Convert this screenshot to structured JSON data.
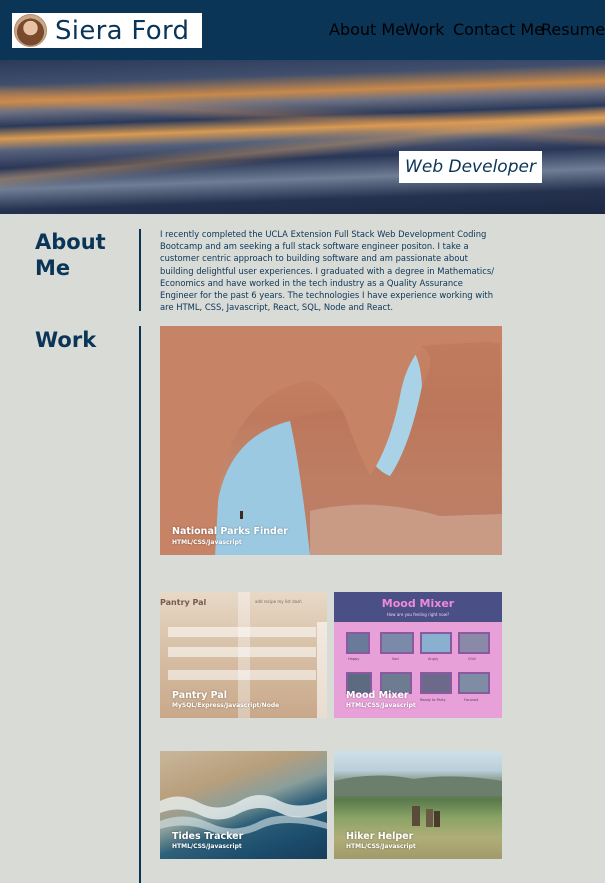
{
  "header": {
    "brand_name": "Siera Ford",
    "nav": [
      "About Me",
      "Work",
      "Contact Me",
      "Resume"
    ]
  },
  "hero": {
    "badge": "Web Developer"
  },
  "about": {
    "title": "About Me",
    "text": "I recently completed the UCLA Extension Full Stack Web Development Coding Bootcamp and am seeking a full stack software engineer positon. I take a customer centric approach to building software and am passionate about building delightful user experiences. I graduated with a degree in Mathematics/ Economics and have worked in the tech industry as a Quality Assurance Engineer for the past 6 years. The technologies I have experience working with are HTML, CSS, Javascript, React, SQL, Node and React."
  },
  "work": {
    "title": "Work",
    "projects": [
      {
        "title": "National Parks Finder",
        "tech": "HTML/CSS/Javascript"
      },
      {
        "title": "Pantry Pal",
        "tech": "MySQL/Express/Javascript/Node",
        "app_title": "Pantry Pal",
        "app_subtitle": "add recipe   my list   dash"
      },
      {
        "title": "Mood Mixer",
        "tech": "HTML/CSS/Javascript",
        "app_title": "Mood Mixer",
        "app_subtitle": "How are you feeling right now?",
        "moods": [
          "Happy",
          "Sad",
          "Angry",
          "Chill",
          "Ready to Party",
          "Focused"
        ]
      },
      {
        "title": "Tides Tracker",
        "tech": "HTML/CSS/Javascript"
      },
      {
        "title": "Hiker Helper",
        "tech": "HTML/CSS/Javascript"
      }
    ]
  },
  "colors": {
    "navy": "#0b3557",
    "page_bg": "#d9dbd7",
    "white": "#ffffff",
    "mood_bg": "#e7a0d8",
    "mood_header": "#4a4f86"
  }
}
